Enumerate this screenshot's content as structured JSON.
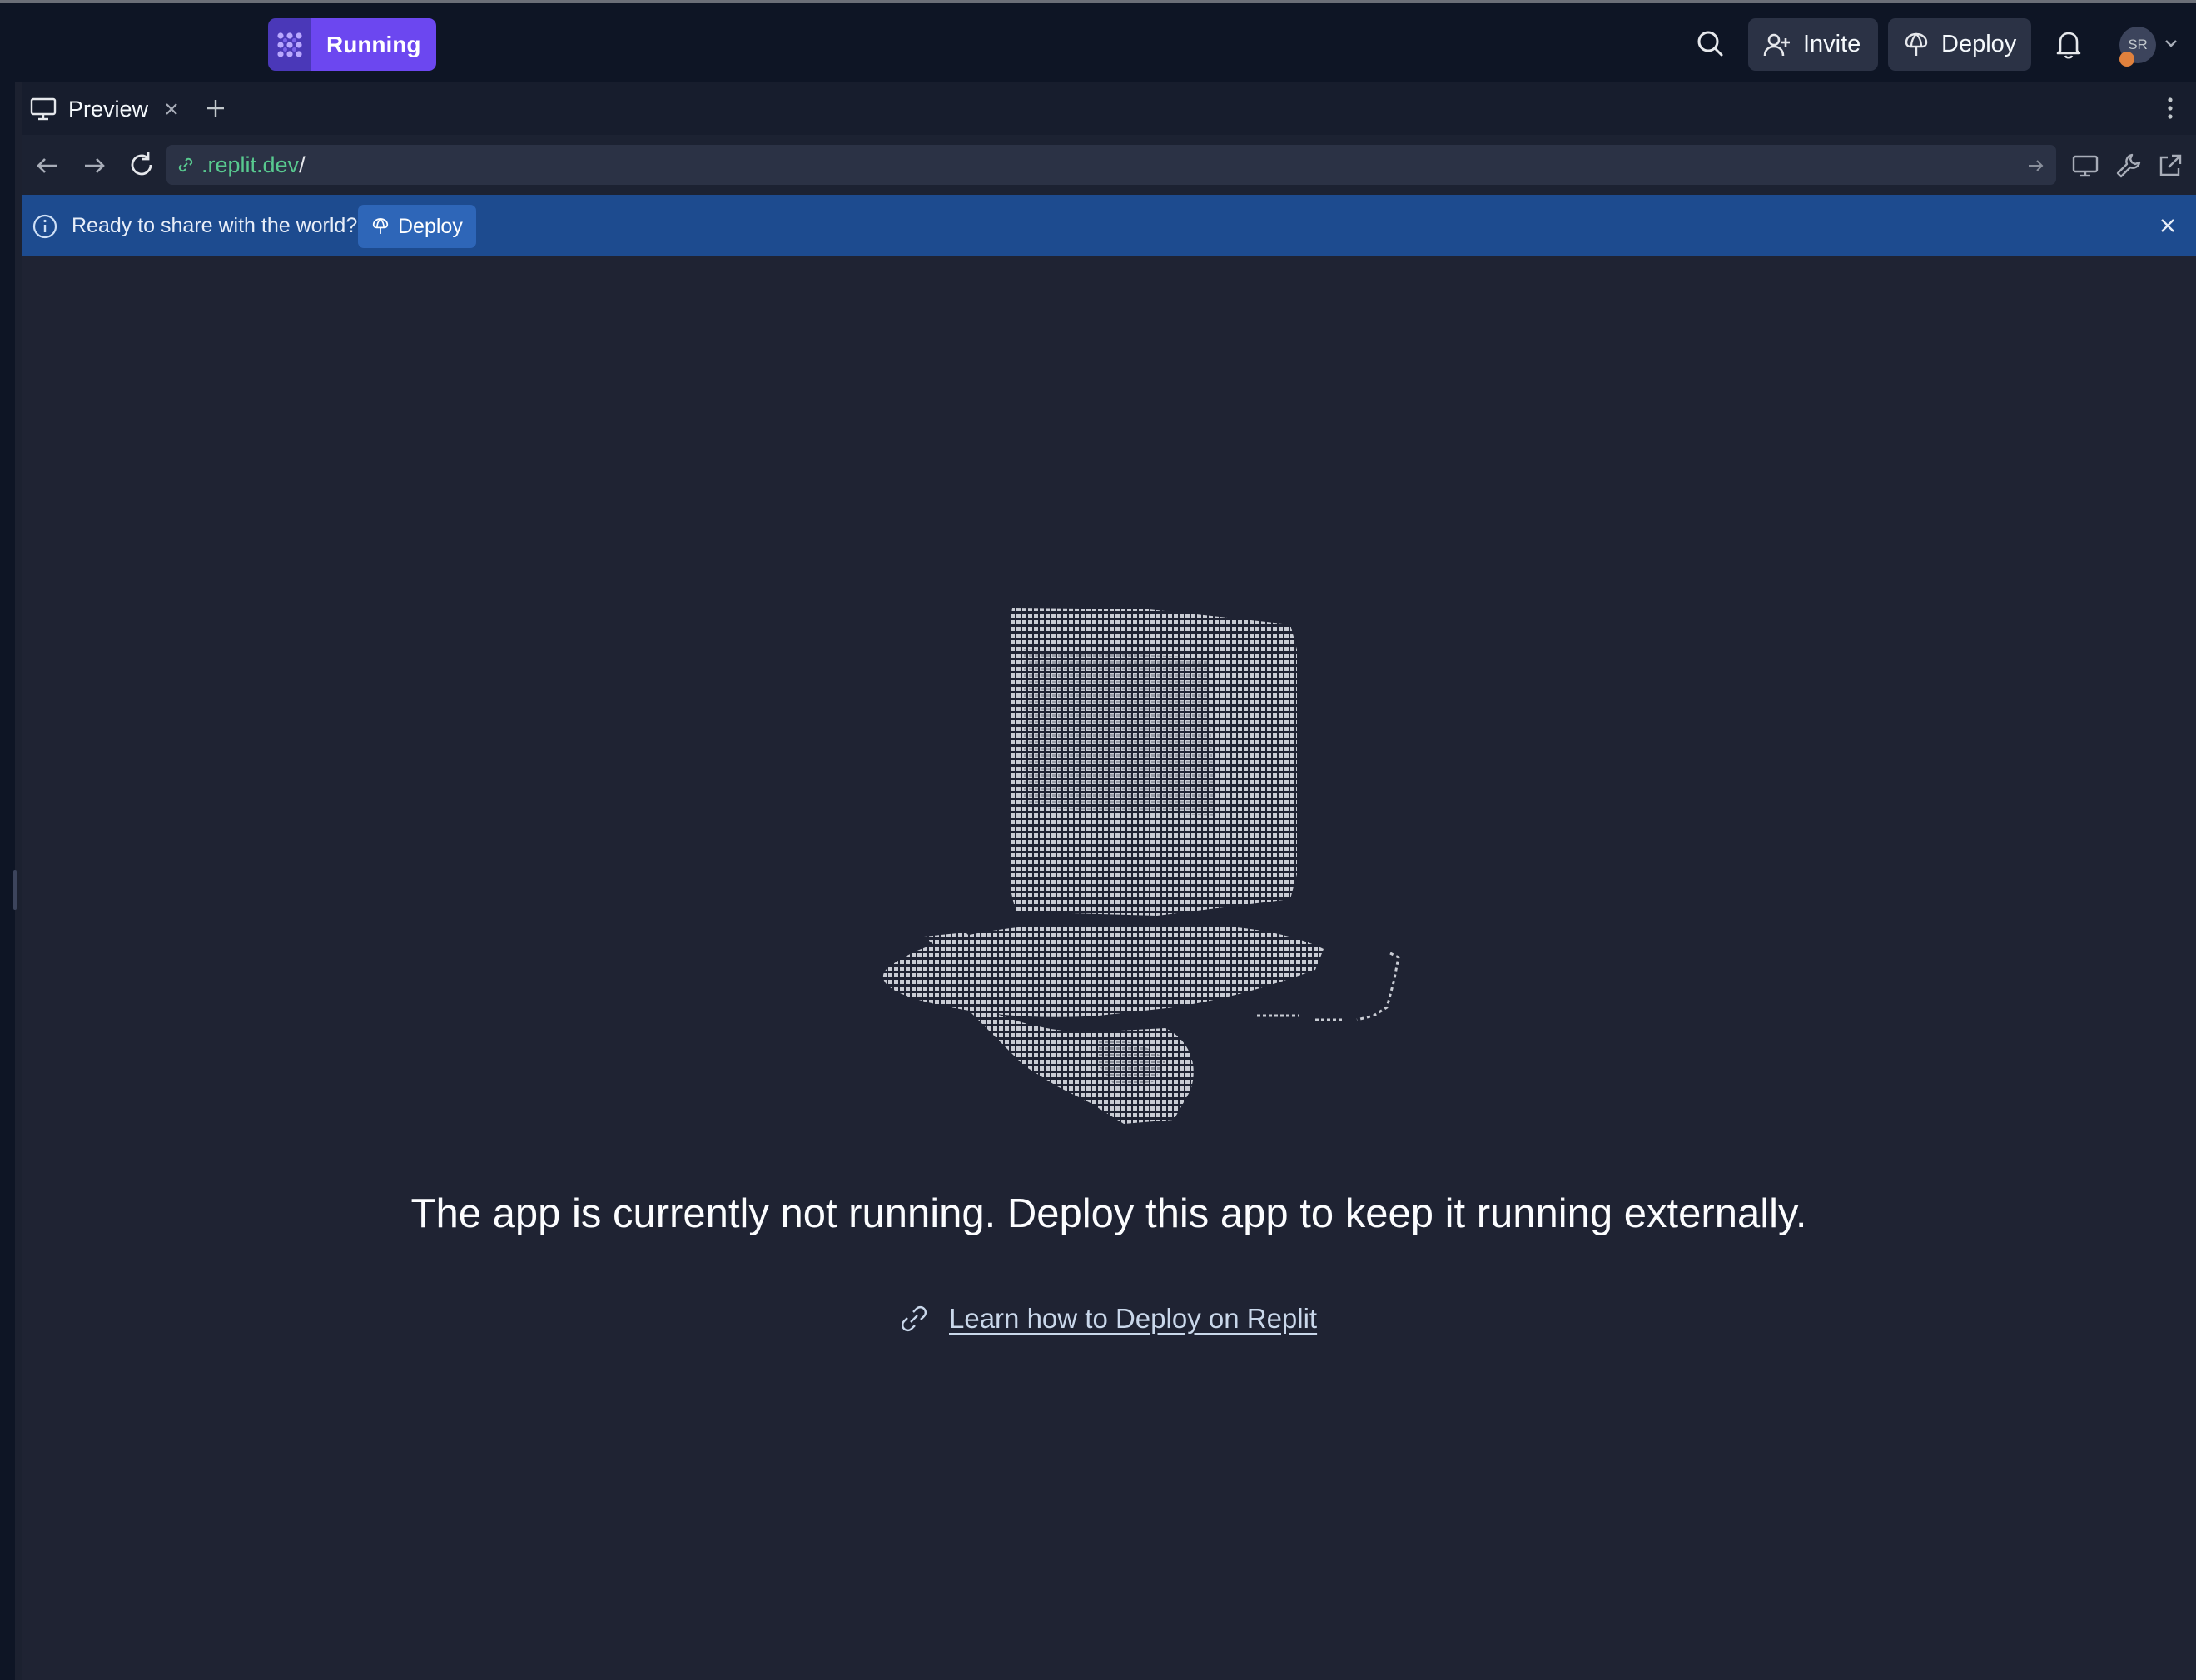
{
  "topbar": {
    "run_status": "Running",
    "invite_label": "Invite",
    "deploy_label": "Deploy",
    "avatar_initials": "SR"
  },
  "tabs": [
    {
      "label": "Preview",
      "active": true
    }
  ],
  "address_bar": {
    "url_host": ".replit.dev",
    "url_path": "/"
  },
  "banner": {
    "text": "Ready to share with the world?",
    "deploy_label": "Deploy"
  },
  "main": {
    "message": "The app is currently not running. Deploy this app to keep it running externally.",
    "learn_link": "Learn how to Deploy on Replit"
  },
  "icons": {
    "run": "replit-logo-icon",
    "search": "search-icon",
    "invite": "person-add-icon",
    "deploy": "deploy-icon",
    "notifications": "bell-icon",
    "tab": "monitor-icon",
    "link": "link-icon"
  },
  "colors": {
    "topbar_bg": "#0e1525",
    "accent_purple": "#6c47f0",
    "banner_blue": "#1d4b8f",
    "content_bg": "#1f2333",
    "url_green": "#58c98f"
  }
}
